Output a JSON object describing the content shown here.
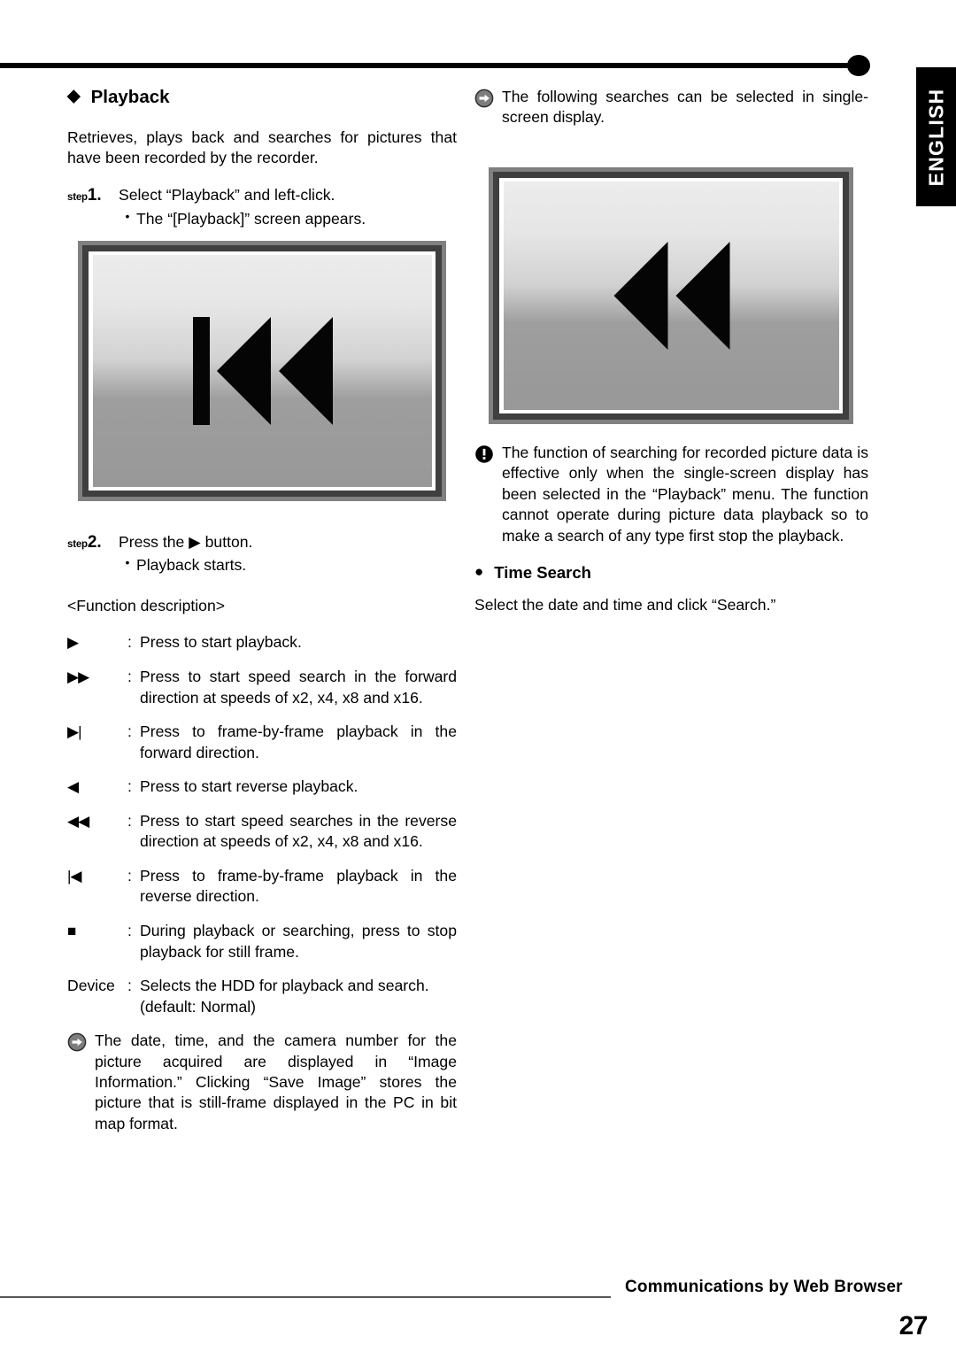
{
  "page": {
    "language_tab": "ENGLISH",
    "number": "27",
    "footer_title": "Communications by Web Browser"
  },
  "left_column": {
    "heading": {
      "bullet_icon": "diamond-bullet",
      "text": "Playback"
    },
    "intro": "Retrieves, plays back and searches for pictures that have been recorded by the recorder.",
    "steps": [
      {
        "prefix": "step",
        "number": "1.",
        "text": "Select “Playback” and left-click.",
        "bullet": "•",
        "sub": "The “[Playback]” screen appears."
      },
      {
        "prefix": "step",
        "number": "2.",
        "text": "Press the ▶ button.",
        "bullet": "•",
        "sub": "Playback starts."
      }
    ],
    "screenshot": {
      "caption": "playback-screen-rewind-to-start-button",
      "glyph": "skip-backward"
    },
    "function_description": {
      "title": "<Function description>",
      "rows": [
        {
          "key": "▶",
          "key_kind": "glyph",
          "colon": ":",
          "desc": "Press to start playback."
        },
        {
          "key": "▶▶",
          "key_kind": "glyph",
          "colon": ":",
          "desc": "Press to start speed search in the forward direction at speeds of x2, x4, x8 and x16."
        },
        {
          "key": "▶|",
          "key_kind": "glyph",
          "colon": ":",
          "desc": "Press to frame-by-frame playback in the forward direction."
        },
        {
          "key": "◀",
          "key_kind": "glyph",
          "colon": ":",
          "desc": "Press to start reverse playback."
        },
        {
          "key": "◀◀",
          "key_kind": "glyph",
          "colon": ":",
          "desc": "Press to start speed searches in the reverse direction at speeds of x2, x4, x8 and x16."
        },
        {
          "key": "|◀",
          "key_kind": "glyph",
          "colon": ":",
          "desc": "Press to frame-by-frame playback in the reverse direction."
        },
        {
          "key": "■",
          "key_kind": "glyph",
          "colon": ":",
          "desc": "During playback or searching, press to stop playback for still frame."
        },
        {
          "key": "Device",
          "key_kind": "text",
          "colon": ":",
          "desc": "Selects the HDD for playback and search. (default: Normal)"
        }
      ]
    },
    "note": {
      "icon": "note-arrow-icon",
      "text": "The date, time, and the camera number for the picture acquired are displayed in “Image Information.” Clicking “Save Image” stores the picture that is still-frame displayed in the PC in bit map format."
    }
  },
  "right_column": {
    "note": {
      "icon": "note-arrow-icon",
      "text": "The following searches can be selected in single-screen display."
    },
    "screenshot": {
      "caption": "search-screen-fast-rewind-button",
      "glyph": "fast-rewind"
    },
    "warning": {
      "icon": "warning-exclamation-icon",
      "text": "The function of searching for recorded picture data is effective only when the single-screen display has been selected in the “Playback” menu. The function cannot operate during picture data playback so to make a search of any type first stop the playback."
    },
    "subheading": {
      "bullet_icon": "round-bullet",
      "text": "Time Search"
    },
    "subtext": "Select the date and time and click “Search.”"
  },
  "colors": {
    "text": "#000000",
    "tab_background": "#000000",
    "tab_text": "#ffffff",
    "rule": "#000000",
    "footer_rule": "#555555",
    "shot_border_outer": "#808080",
    "shot_border_inner": "#3f3f3f"
  }
}
